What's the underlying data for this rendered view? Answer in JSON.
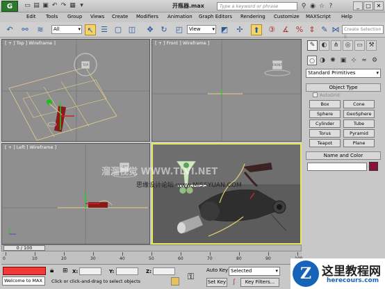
{
  "window": {
    "title": "开瓶器.max",
    "search_placeholder": "Type a keyword or phrase",
    "logo": "G",
    "min": "_",
    "max": "□",
    "close": "✕"
  },
  "menu": [
    "Edit",
    "Tools",
    "Group",
    "Views",
    "Create",
    "Modifiers",
    "Animation",
    "Graph Editors",
    "Rendering",
    "Customize",
    "MAXScript",
    "Help"
  ],
  "toolbar": {
    "filter_value": "All",
    "refcoord_value": "View",
    "named_sel_placeholder": "Create Selection S"
  },
  "viewports": {
    "top_label": "[ + ] Top ] Wireframe ]",
    "front_label": "[ + ] Front ] Wireframe ]",
    "left_label": "[ + ] Left ] Wireframe ]",
    "persp_label": "",
    "cube_top": "TOP",
    "cube_front": "FRONT",
    "cube_left": "LEFT"
  },
  "command_panel": {
    "category": "Standard Primitives",
    "object_type_title": "Object Type",
    "autogrid": "AutoGrid",
    "buttons": [
      "Box",
      "Cone",
      "Sphere",
      "GeoSphere",
      "Cylinder",
      "Tube",
      "Torus",
      "Pyramid",
      "Teapot",
      "Plane"
    ],
    "name_color_title": "Name and Color",
    "object_color": "#8a1238"
  },
  "timeline": {
    "slider_text": "0 / 100",
    "ticks": [
      "0",
      "10",
      "20",
      "30",
      "40",
      "50",
      "60",
      "70",
      "80",
      "90",
      "100"
    ]
  },
  "status": {
    "welcome": "Welcome to MAX",
    "prompt": "Click or click-and-drag to select objects",
    "x_label": "X:",
    "y_label": "Y:",
    "z_label": "Z:",
    "auto_key": "Auto Key",
    "set_key": "Set Key",
    "selected": "Selected",
    "key_filters": "Key Filters..."
  },
  "watermark": {
    "cn": "这里教程网",
    "en": "herecours.com",
    "overlay1": "思缘设计论坛 www.MISSYUAN.COM",
    "overlay2": "溜溜视觉 WWW.TLVI.NET"
  }
}
